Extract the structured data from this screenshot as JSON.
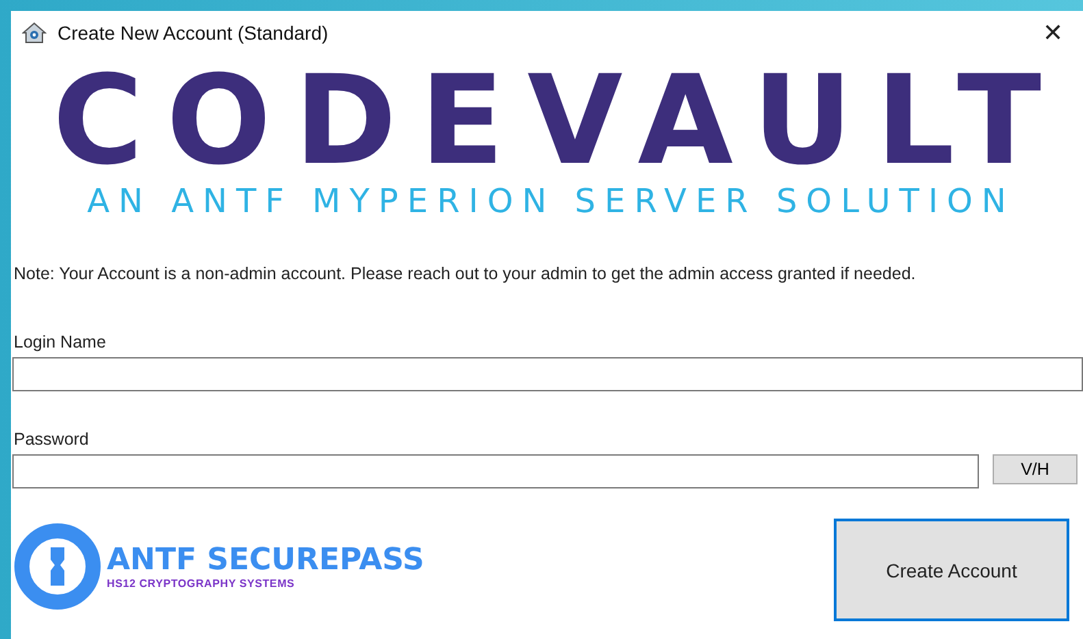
{
  "window": {
    "title": "Create New Account (Standard)",
    "close": "✕"
  },
  "logo": {
    "title": "CODEVAULT",
    "subtitle": "AN ANTF MYPERION SERVER SOLUTION"
  },
  "note": "Note: Your Account is a non-admin account. Please reach out to your admin to get the admin access granted if needed.",
  "fields": [
    {
      "label": "Login Name"
    },
    {
      "label": "Password",
      "toggle": "V/H"
    }
  ],
  "brand": {
    "name": "ANTF SECUREPASS",
    "tagline": "HS12 CRYPTOGRAPHY SYSTEMS"
  },
  "button": {
    "label": "Create Account",
    "focused": true
  }
}
